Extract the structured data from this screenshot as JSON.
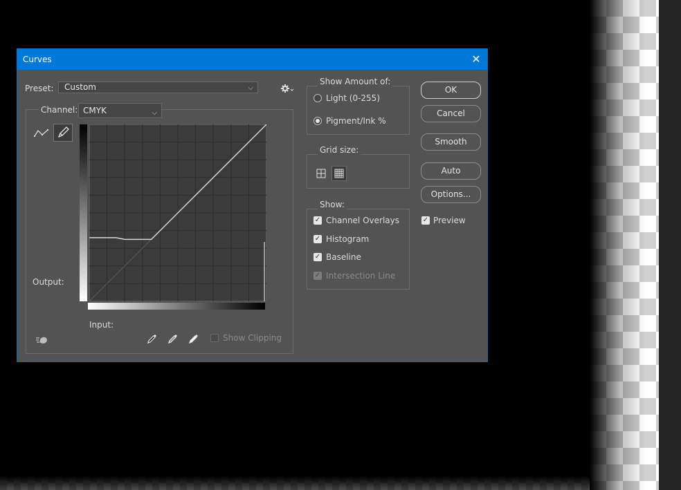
{
  "dialog": {
    "title": "Curves"
  },
  "preset": {
    "label": "Preset:",
    "value": "Custom"
  },
  "channel": {
    "label": "Channel:",
    "value": "CMYK"
  },
  "curve": {
    "output_label": "Output:",
    "input_label": "Input:",
    "points": [
      [
        0,
        36
      ],
      [
        15,
        36
      ],
      [
        20,
        35
      ],
      [
        35,
        35
      ],
      [
        100,
        100
      ]
    ]
  },
  "show_clipping": {
    "label": "Show Clipping",
    "checked": false
  },
  "show_amount": {
    "title": "Show Amount of:",
    "options": [
      {
        "label": "Light  (0-255)",
        "selected": false
      },
      {
        "label": "Pigment/Ink %",
        "selected": true
      }
    ]
  },
  "grid_size": {
    "title": "Grid size:"
  },
  "show": {
    "title": "Show:",
    "items": [
      {
        "label": "Channel Overlays",
        "checked": true,
        "enabled": true
      },
      {
        "label": "Histogram",
        "checked": true,
        "enabled": true
      },
      {
        "label": "Baseline",
        "checked": true,
        "enabled": true
      },
      {
        "label": "Intersection Line",
        "checked": true,
        "enabled": false
      }
    ]
  },
  "buttons": {
    "ok": "OK",
    "cancel": "Cancel",
    "smooth": "Smooth",
    "auto": "Auto",
    "options": "Options..."
  },
  "preview": {
    "label": "Preview",
    "checked": true
  }
}
